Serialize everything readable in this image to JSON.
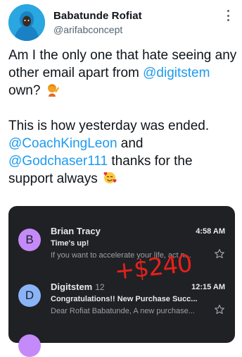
{
  "user": {
    "name": "Babatunde Rofiat",
    "handle": "@arifabconcept",
    "avatar_icon": "avatar-person-icon",
    "accent": "#2aa6e0"
  },
  "tweet": {
    "p1_text": "Am I the only one that hate seeing any other email apart from ",
    "p1_mention": "@digitstem",
    "p1_tail": " own?",
    "p1_emoji": "person-facepalming-emoji",
    "p2_line1": "This is how yesterday was ended.",
    "p2_mention1": "@CoachKingLeon",
    "p2_and": " and",
    "p2_mention2": "@Godchaser111",
    "p2_tail": " thanks for the support always",
    "p2_emoji": "smiling-face-with-hearts-emoji",
    "mention_color": "#1d9bf0"
  },
  "emails": [
    {
      "initial": "B",
      "badge_color": "#c58af9",
      "sender": "Brian Tracy",
      "count": "",
      "time": "4:58 AM",
      "subject": "Time's up!",
      "preview": "If you want to accelerate your life, act n..."
    },
    {
      "initial": "D",
      "badge_color": "#8ab4f8",
      "sender": "Digitstem",
      "count": "12",
      "time": "12:15 AM",
      "subject": "Congratulations!! New Purchase Succ...",
      "preview": "Dear Rofiat Babatunde, A new purchase..."
    }
  ],
  "overlay_text": "+$240",
  "overlay_color": "#e4211c"
}
